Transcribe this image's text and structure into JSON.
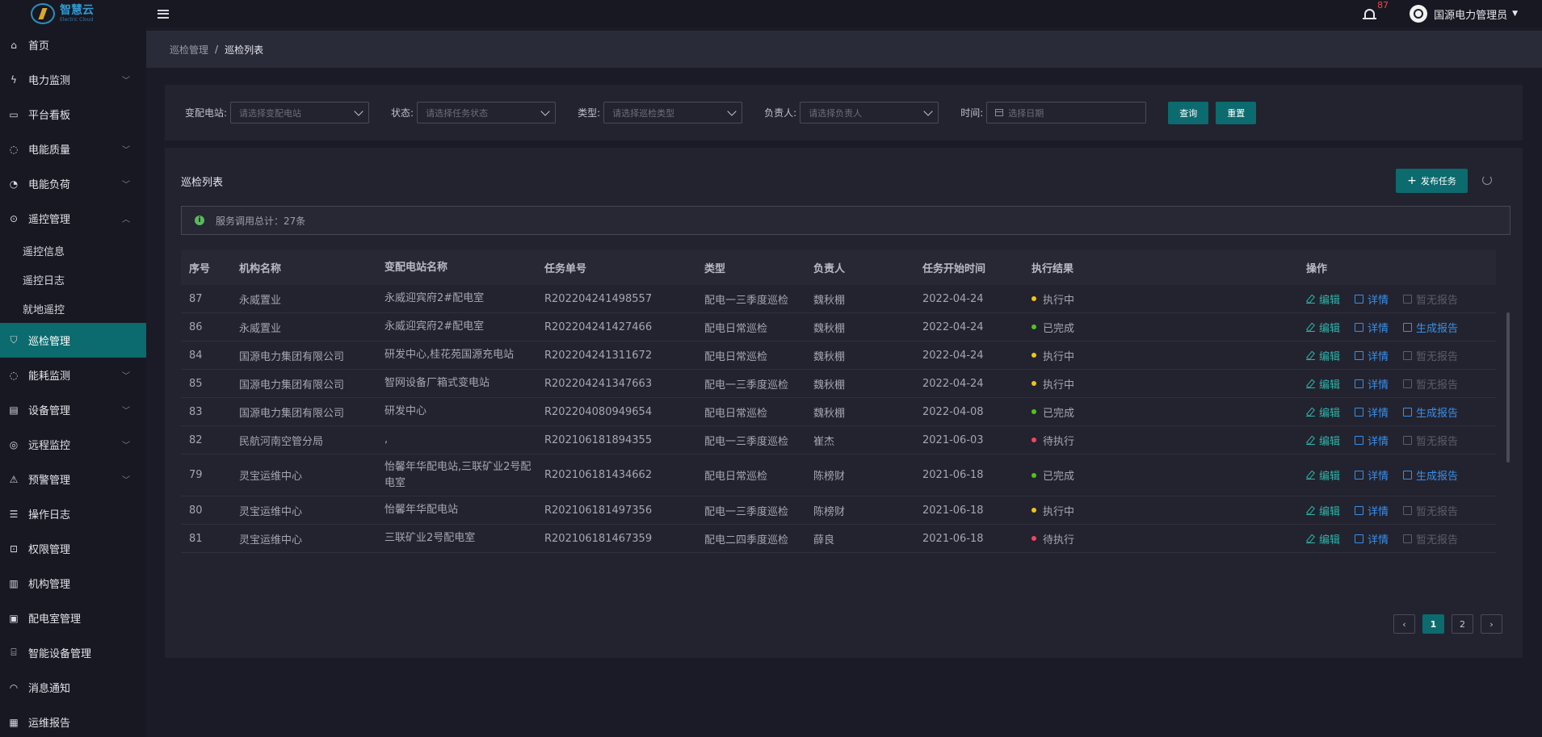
{
  "app": {
    "logo_cn": "智慧云",
    "logo_en": "Electric Cloud"
  },
  "topbar": {
    "notification_count": "87",
    "user_name": "国源电力管理员"
  },
  "sidebar": {
    "items": [
      {
        "label": "首页",
        "icon": "home-icon",
        "chevron": ""
      },
      {
        "label": "电力监测",
        "icon": "bolt-icon",
        "chevron": "﹀"
      },
      {
        "label": "平台看板",
        "icon": "monitor-icon",
        "chevron": ""
      },
      {
        "label": "电能质量",
        "icon": "bulb-icon",
        "chevron": "﹀"
      },
      {
        "label": "电能负荷",
        "icon": "gauge-icon",
        "chevron": "﹀"
      },
      {
        "label": "遥控管理",
        "icon": "remote-icon",
        "chevron": "︿"
      }
    ],
    "sub_items": [
      "遥控信息",
      "遥控日志",
      "就地遥控"
    ],
    "items2": [
      {
        "label": "巡检管理",
        "icon": "shield-icon",
        "chevron": ""
      },
      {
        "label": "能耗监测",
        "icon": "bulb-icon",
        "chevron": "﹀"
      },
      {
        "label": "设备管理",
        "icon": "device-icon",
        "chevron": "﹀"
      },
      {
        "label": "远程监控",
        "icon": "camera-icon",
        "chevron": "﹀"
      },
      {
        "label": "预警管理",
        "icon": "alert-icon",
        "chevron": "﹀"
      },
      {
        "label": "操作日志",
        "icon": "log-icon",
        "chevron": ""
      },
      {
        "label": "权限管理",
        "icon": "lock-icon",
        "chevron": ""
      },
      {
        "label": "机构管理",
        "icon": "building-icon",
        "chevron": ""
      },
      {
        "label": "配电室管理",
        "icon": "power-room-icon",
        "chevron": ""
      },
      {
        "label": "智能设备管理",
        "icon": "router-icon",
        "chevron": ""
      },
      {
        "label": "消息通知",
        "icon": "bell-icon",
        "chevron": ""
      },
      {
        "label": "运维报告",
        "icon": "report-icon",
        "chevron": ""
      }
    ]
  },
  "breadcrumb": {
    "parent": "巡检管理",
    "separator": "/",
    "current": "巡检列表"
  },
  "filters": {
    "station_label": "变配电站:",
    "station_placeholder": "请选择变配电站",
    "status_label": "状态:",
    "status_placeholder": "请选择任务状态",
    "type_label": "类型:",
    "type_placeholder": "请选择巡检类型",
    "owner_label": "负责人:",
    "owner_placeholder": "请选择负责人",
    "time_label": "时间:",
    "time_placeholder": "选择日期",
    "query_button": "查询",
    "reset_button": "重置"
  },
  "list": {
    "title": "巡检列表",
    "publish_button": "发布任务",
    "info_text": "服务调用总计：27条",
    "columns": [
      "序号",
      "机构名称",
      "变配电站名称",
      "任务单号",
      "类型",
      "负责人",
      "任务开始时间",
      "执行结果",
      "操作"
    ],
    "actions": {
      "edit": "编辑",
      "detail": "详情",
      "report": "生成报告",
      "no_report": "暂无报告"
    },
    "rows": [
      {
        "id": "87",
        "org": "永威置业",
        "station": "永威迎宾府2#配电室",
        "task_no": "R202204241498557",
        "type": "配电一三季度巡检",
        "owner": "魏秋棚",
        "start": "2022-04-24",
        "result": "执行中",
        "result_color": "#f0c419",
        "report": "暂无报告"
      },
      {
        "id": "86",
        "org": "永威置业",
        "station": "永威迎宾府2#配电室",
        "task_no": "R202204241427466",
        "type": "配电日常巡检",
        "owner": "魏秋棚",
        "start": "2022-04-24",
        "result": "已完成",
        "result_color": "#52c41a",
        "report": "生成报告"
      },
      {
        "id": "84",
        "org": "国源电力集团有限公司",
        "station": "研发中心,桂花苑国源充电站",
        "task_no": "R202204241311672",
        "type": "配电日常巡检",
        "owner": "魏秋棚",
        "start": "2022-04-24",
        "result": "执行中",
        "result_color": "#f0c419",
        "report": "暂无报告"
      },
      {
        "id": "85",
        "org": "国源电力集团有限公司",
        "station": "智网设备厂箱式变电站",
        "task_no": "R202204241347663",
        "type": "配电一三季度巡检",
        "owner": "魏秋棚",
        "start": "2022-04-24",
        "result": "执行中",
        "result_color": "#f0c419",
        "report": "暂无报告"
      },
      {
        "id": "83",
        "org": "国源电力集团有限公司",
        "station": "研发中心",
        "task_no": "R202204080949654",
        "type": "配电日常巡检",
        "owner": "魏秋棚",
        "start": "2022-04-08",
        "result": "已完成",
        "result_color": "#52c41a",
        "report": "生成报告"
      },
      {
        "id": "82",
        "org": "民航河南空管分局",
        "station": ",",
        "task_no": "R202106181894355",
        "type": "配电一三季度巡检",
        "owner": "崔杰",
        "start": "2021-06-03",
        "result": "待执行",
        "result_color": "#f5455c",
        "report": "暂无报告"
      },
      {
        "id": "79",
        "org": "灵宝运维中心",
        "station": "怡馨年华配电站,三联矿业2号配电室",
        "task_no": "R202106181434662",
        "type": "配电日常巡检",
        "owner": "陈榜财",
        "start": "2021-06-18",
        "result": "已完成",
        "result_color": "#52c41a",
        "report": "生成报告"
      },
      {
        "id": "80",
        "org": "灵宝运维中心",
        "station": "怡馨年华配电站",
        "task_no": "R202106181497356",
        "type": "配电一三季度巡检",
        "owner": "陈榜财",
        "start": "2021-06-18",
        "result": "执行中",
        "result_color": "#f0c419",
        "report": "暂无报告"
      },
      {
        "id": "81",
        "org": "灵宝运维中心",
        "station": "三联矿业2号配电室",
        "task_no": "R202106181467359",
        "type": "配电二四季度巡检",
        "owner": "薛良",
        "start": "2021-06-18",
        "result": "待执行",
        "result_color": "#f5455c",
        "report": "暂无报告"
      }
    ]
  },
  "pagination": {
    "prev": "‹",
    "pages": [
      "1",
      "2"
    ],
    "current": "1",
    "next": "›"
  },
  "colors": {
    "accent": "#0b6b6e",
    "edit": "#2fb3a8",
    "link": "#3a8fe8"
  }
}
